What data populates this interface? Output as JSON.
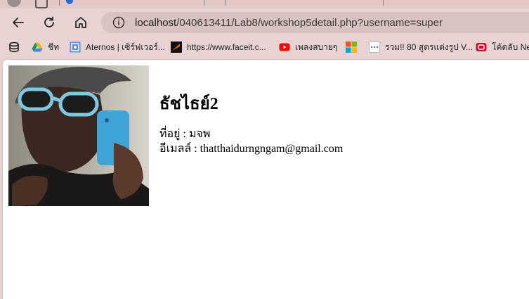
{
  "browser": {
    "url_host": "localhost",
    "url_path": "/040613411/Lab8/workshop5detail.php?username=super",
    "bookmarks": [
      {
        "icon": "apps-stack-icon",
        "label": ""
      },
      {
        "icon": "google-drive-icon",
        "label": "ชีท"
      },
      {
        "icon": "aternos-icon",
        "label": "Aternos | เซิร์ฟเวอร์..."
      },
      {
        "icon": "faceit-icon",
        "label": "https://www.faceit.c..."
      },
      {
        "icon": "youtube-icon",
        "label": "เพลงสบายๆ"
      },
      {
        "icon": "microsoft-icon",
        "label": ""
      },
      {
        "icon": "dots-icon",
        "label": "รวม!! 80 สูตรแต่งรูป V..."
      },
      {
        "icon": "line-tv-icon",
        "label": "โค้ดลับ Net"
      }
    ]
  },
  "profile": {
    "name": "ธัชไธย์2",
    "address": "ที่อยู่ : มจพ",
    "email": "อีเมลล์ : thatthaidurngngam@gmail.com"
  },
  "colors": {
    "chrome": "#e7d3d1",
    "url_box": "#d9c3c1",
    "page": "#ffffff"
  }
}
